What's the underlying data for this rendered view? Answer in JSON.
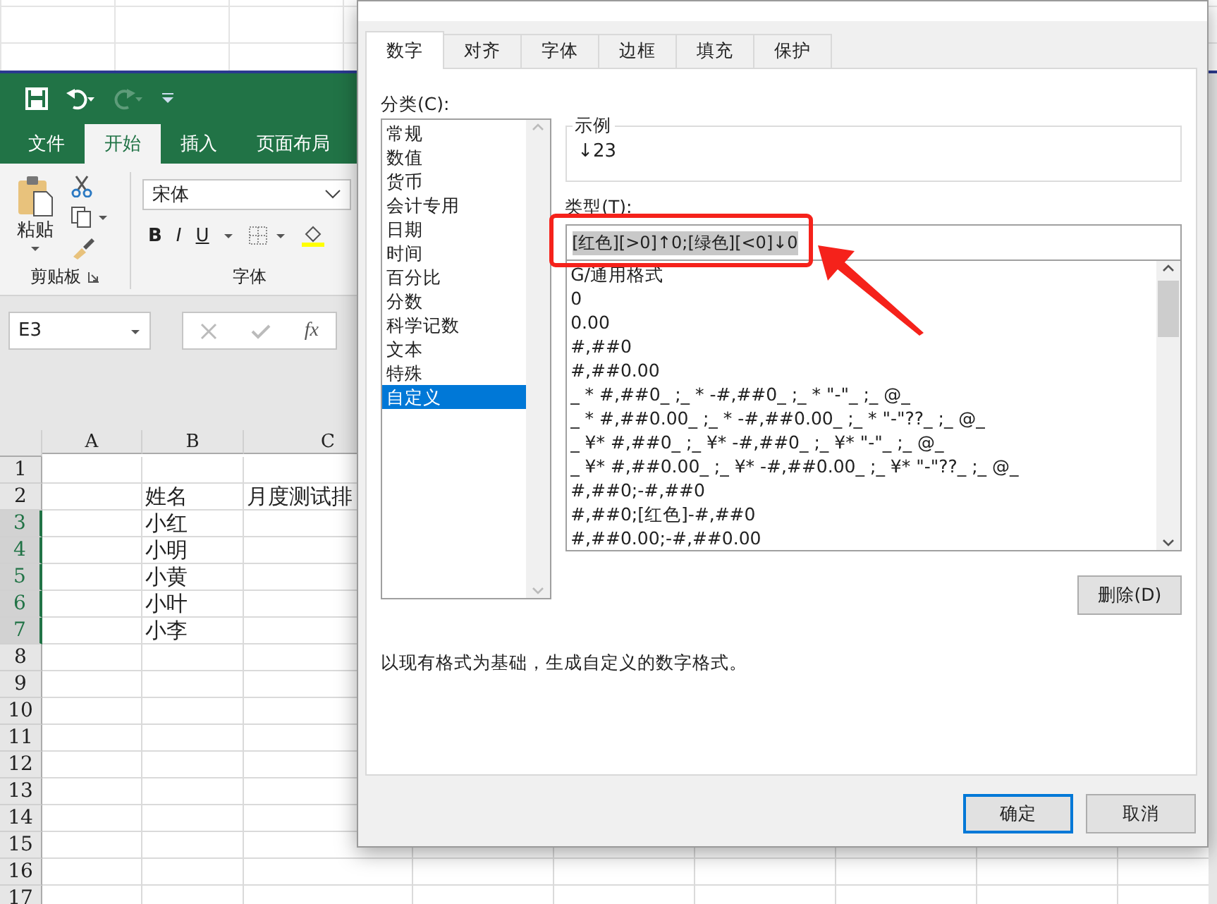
{
  "excel": {
    "tabs": [
      {
        "label": "文件",
        "selected": false
      },
      {
        "label": "开始",
        "selected": true
      },
      {
        "label": "插入",
        "selected": false
      },
      {
        "label": "页面布局",
        "selected": false
      }
    ],
    "ribbon": {
      "paste_label": "粘贴",
      "clipboard_group": "剪贴板",
      "font_name": "宋体",
      "bold": "B",
      "italic": "I",
      "underline": "U",
      "font_group": "字体"
    },
    "name_box": "E3",
    "formula_label": "fx",
    "sheet": {
      "columns": [
        "A",
        "B",
        "C"
      ],
      "rows": [
        {
          "number": "1",
          "selected": false
        },
        {
          "number": "2",
          "selected": false,
          "b": "姓名",
          "c": "月度测试排"
        },
        {
          "number": "3",
          "selected": true,
          "b": "小红"
        },
        {
          "number": "4",
          "selected": true,
          "b": "小明"
        },
        {
          "number": "5",
          "selected": true,
          "b": "小黄"
        },
        {
          "number": "6",
          "selected": true,
          "b": "小叶"
        },
        {
          "number": "7",
          "selected": true,
          "b": "小李"
        },
        {
          "number": "8",
          "selected": false
        },
        {
          "number": "9",
          "selected": false
        },
        {
          "number": "10",
          "selected": false
        },
        {
          "number": "11",
          "selected": false
        },
        {
          "number": "12",
          "selected": false
        },
        {
          "number": "13",
          "selected": false
        },
        {
          "number": "14",
          "selected": false
        },
        {
          "number": "15",
          "selected": false
        },
        {
          "number": "16",
          "selected": false
        },
        {
          "number": "17",
          "selected": false
        }
      ]
    }
  },
  "dialog": {
    "tabs": [
      {
        "label": "数字",
        "selected": true
      },
      {
        "label": "对齐",
        "selected": false
      },
      {
        "label": "字体",
        "selected": false
      },
      {
        "label": "边框",
        "selected": false
      },
      {
        "label": "填充",
        "selected": false
      },
      {
        "label": "保护",
        "selected": false
      }
    ],
    "category_label": "分类(C):",
    "categories": [
      {
        "label": "常规",
        "selected": false
      },
      {
        "label": "数值",
        "selected": false
      },
      {
        "label": "货币",
        "selected": false
      },
      {
        "label": "会计专用",
        "selected": false
      },
      {
        "label": "日期",
        "selected": false
      },
      {
        "label": "时间",
        "selected": false
      },
      {
        "label": "百分比",
        "selected": false
      },
      {
        "label": "分数",
        "selected": false
      },
      {
        "label": "科学记数",
        "selected": false
      },
      {
        "label": "文本",
        "selected": false
      },
      {
        "label": "特殊",
        "selected": false
      },
      {
        "label": "自定义",
        "selected": true
      }
    ],
    "sample_label": "示例",
    "sample_value": "↓23",
    "type_label": "类型(T):",
    "type_value": "[红色][>0]↑0;[绿色][<0]↓0",
    "formats": [
      "G/通用格式",
      "0",
      "0.00",
      "#,##0",
      "#,##0.00",
      "_ * #,##0_ ;_ * -#,##0_ ;_ * \"-\"_ ;_ @_",
      "_ * #,##0.00_ ;_ * -#,##0.00_ ;_ * \"-\"??_ ;_ @_",
      "_ ¥* #,##0_ ;_ ¥* -#,##0_ ;_ ¥* \"-\"_ ;_ @_",
      "_ ¥* #,##0.00_ ;_ ¥* -#,##0.00_ ;_ ¥* \"-\"??_ ;_ @_",
      "#,##0;-#,##0",
      "#,##0;[红色]-#,##0",
      "#,##0.00;-#,##0.00"
    ],
    "delete_button": "删除(D)",
    "description": "以现有格式为基础，生成自定义的数字格式。",
    "buttons": [
      {
        "label": "确定",
        "default": true
      },
      {
        "label": "取消",
        "default": false
      }
    ]
  }
}
